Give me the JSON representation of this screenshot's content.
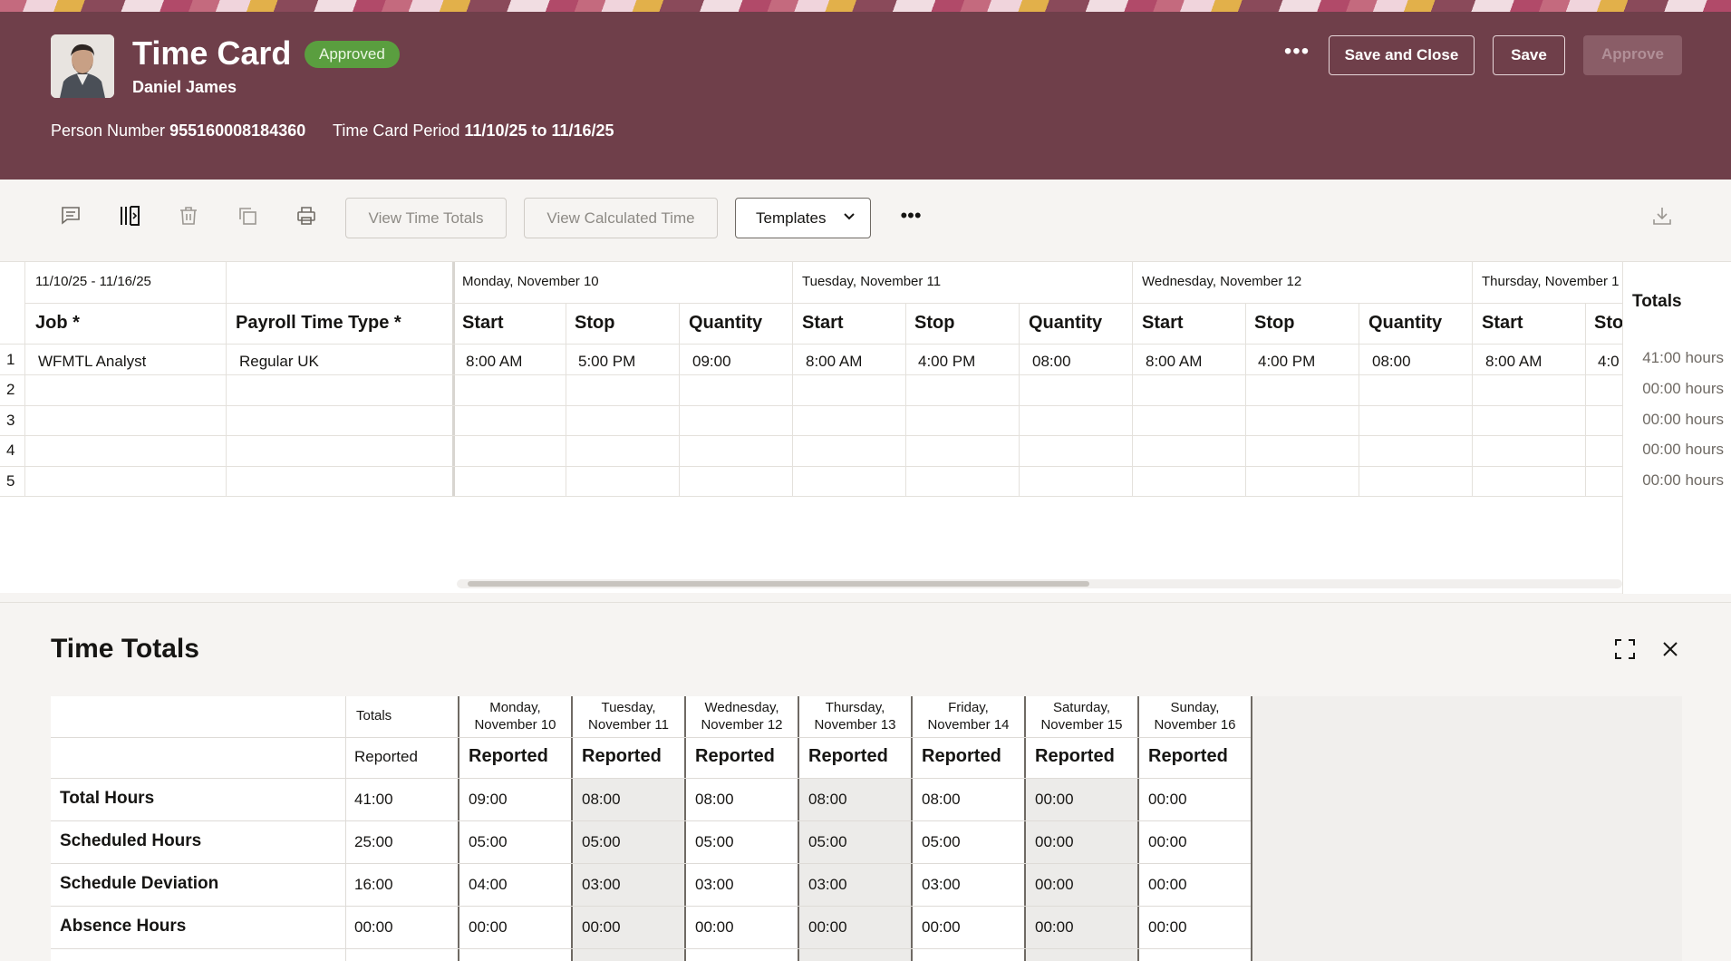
{
  "header": {
    "title": "Time Card",
    "status": "Approved",
    "person_name": "Daniel James",
    "person_number_label": "Person Number",
    "person_number": "955160008184360",
    "period_label": "Time Card Period",
    "period": "11/10/25 to 11/16/25",
    "more_label": "•••",
    "save_close_label": "Save and Close",
    "save_label": "Save",
    "approve_label": "Approve"
  },
  "toolbar": {
    "view_time_totals_label": "View Time Totals",
    "view_calculated_time_label": "View Calculated Time",
    "templates_label": "Templates",
    "more_label": "•••",
    "icons": [
      "comment-icon",
      "freeze-columns-icon",
      "delete-icon",
      "copy-icon",
      "print-icon",
      "download-icon"
    ]
  },
  "grid": {
    "period": "11/10/25 - 11/16/25",
    "job_header": "Job *",
    "payroll_header": "Payroll Time Type *",
    "totals_header": "Totals",
    "days": [
      {
        "date": "Monday, November 10",
        "start": "Start",
        "stop": "Stop",
        "quantity": "Quantity"
      },
      {
        "date": "Tuesday, November 11",
        "start": "Start",
        "stop": "Stop",
        "quantity": "Quantity"
      },
      {
        "date": "Wednesday, November 12",
        "start": "Start",
        "stop": "Stop",
        "quantity": "Quantity"
      },
      {
        "date": "Thursday, November 1",
        "start": "Start",
        "stop": "Sto",
        "quantity": ""
      }
    ],
    "rows": [
      {
        "num": "1",
        "job": "WFMTL Analyst",
        "payroll": "Regular UK",
        "mon": [
          "8:00 AM",
          "5:00 PM",
          "09:00"
        ],
        "tue": [
          "8:00 AM",
          "4:00 PM",
          "08:00"
        ],
        "wed": [
          "8:00 AM",
          "4:00 PM",
          "08:00"
        ],
        "thu": [
          "8:00 AM",
          "4:0"
        ],
        "total": "41:00 hours"
      },
      {
        "num": "2",
        "total": "00:00 hours"
      },
      {
        "num": "3",
        "total": "00:00 hours"
      },
      {
        "num": "4",
        "total": "00:00 hours"
      },
      {
        "num": "5",
        "total": "00:00 hours"
      }
    ]
  },
  "time_totals": {
    "title": "Time Totals",
    "totals_label": "Totals",
    "totals_sub": "Reported",
    "days": [
      {
        "line1": "Monday,",
        "line2": "November 10",
        "sub": "Reported"
      },
      {
        "line1": "Tuesday,",
        "line2": "November 11",
        "sub": "Reported"
      },
      {
        "line1": "Wednesday,",
        "line2": "November 12",
        "sub": "Reported"
      },
      {
        "line1": "Thursday,",
        "line2": "November 13",
        "sub": "Reported"
      },
      {
        "line1": "Friday,",
        "line2": "November 14",
        "sub": "Reported"
      },
      {
        "line1": "Saturday,",
        "line2": "November 15",
        "sub": "Reported"
      },
      {
        "line1": "Sunday,",
        "line2": "November 16",
        "sub": "Reported"
      }
    ],
    "rows": [
      {
        "label": "Total Hours",
        "total": "41:00",
        "values": [
          "09:00",
          "08:00",
          "08:00",
          "08:00",
          "08:00",
          "00:00",
          "00:00"
        ]
      },
      {
        "label": "Scheduled Hours",
        "total": "25:00",
        "values": [
          "05:00",
          "05:00",
          "05:00",
          "05:00",
          "05:00",
          "00:00",
          "00:00"
        ]
      },
      {
        "label": "Schedule Deviation",
        "total": "16:00",
        "values": [
          "04:00",
          "03:00",
          "03:00",
          "03:00",
          "03:00",
          "00:00",
          "00:00"
        ]
      },
      {
        "label": "Absence Hours",
        "total": "00:00",
        "values": [
          "00:00",
          "00:00",
          "00:00",
          "00:00",
          "00:00",
          "00:00",
          "00:00"
        ]
      }
    ]
  },
  "colors": {
    "header_bg": "#6f3f4a",
    "badge_bg": "#5a9e3f",
    "shaded_column": "#ecebe9"
  }
}
